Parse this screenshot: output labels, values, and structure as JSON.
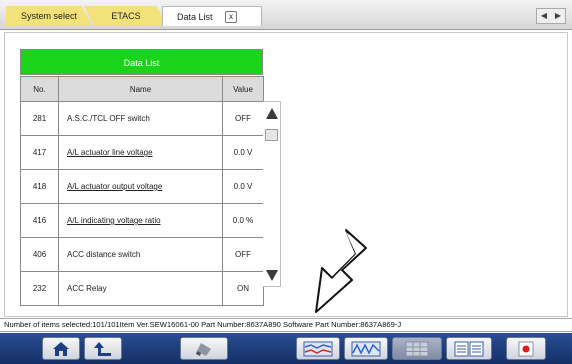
{
  "tabs": {
    "system_select": "System select",
    "etacs": "ETACS",
    "data_list": "Data List",
    "close_glyph": "x",
    "nav_left": "◀",
    "nav_right": "▶"
  },
  "data_list": {
    "title": "Data List",
    "columns": {
      "no": "No.",
      "name": "Name",
      "value": "Value"
    },
    "rows": [
      {
        "no": "281",
        "name": "A.S.C./TCL OFF switch",
        "value": "OFF"
      },
      {
        "no": "417",
        "name": "A/L actuator line voltage",
        "value": "0.0 V"
      },
      {
        "no": "418",
        "name": "A/L actuator output voltage",
        "value": "0.0 V"
      },
      {
        "no": "416",
        "name": "A/L indicating voltage ratio",
        "value": "0.0 %"
      },
      {
        "no": "406",
        "name": "ACC distance switch",
        "value": "OFF"
      },
      {
        "no": "232",
        "name": "ACC Relay",
        "value": "ON"
      }
    ]
  },
  "status": {
    "text": "Number of items selected:101/101Item   Ver.SEW16061-00 Part Number:8637A890   Software Part Number:8637A869-J"
  },
  "toolbar": {
    "buttons": [
      "home-icon",
      "back-icon",
      "erase-icon",
      "graph-icon",
      "waveform-icon",
      "grid-icon",
      "list-graph-icon",
      "record-icon"
    ]
  },
  "colors": {
    "title_bar": "#19d419",
    "tab_yellow": "#f3e27a",
    "toolbar": "#1d3c7a",
    "record": "#e21a1a"
  }
}
